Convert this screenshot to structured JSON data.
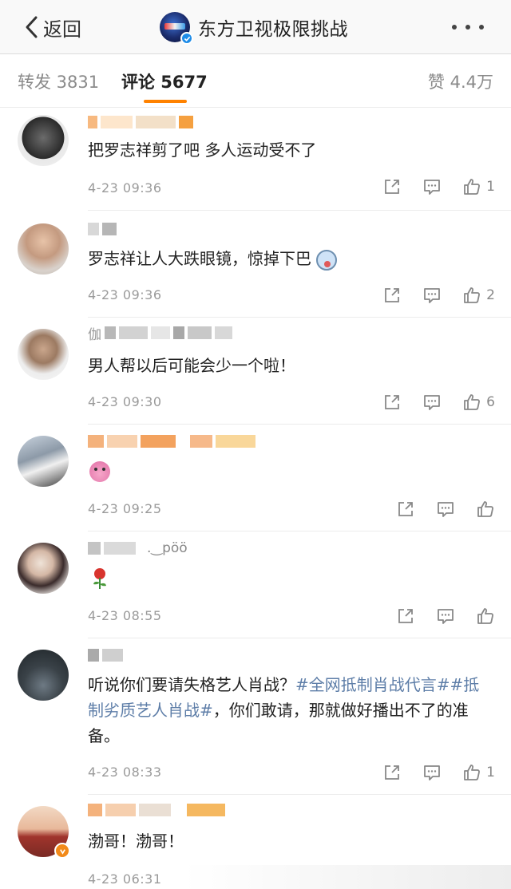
{
  "navbar": {
    "back_label": "返回",
    "title": "东方卫视极限挑战"
  },
  "tabs": {
    "repost": "转发 3831",
    "comment": "评论 5677",
    "like": "赞 4.4万"
  },
  "comments": [
    {
      "text": "把罗志祥剪了吧 多人运动受不了",
      "time": "4-23 09:36",
      "likes": "1"
    },
    {
      "text": "罗志祥让人大跌眼镜，惊掉下巴",
      "time": "4-23 09:36",
      "likes": "2"
    },
    {
      "name_prefix": "伽",
      "text": "男人帮以后可能会少一个啦！",
      "time": "4-23 09:30",
      "likes": "6"
    },
    {
      "text": "",
      "time": "4-23 09:25",
      "likes": ""
    },
    {
      "name_suffix": ".‿pöö",
      "text": "",
      "time": "4-23 08:55",
      "likes": ""
    },
    {
      "text_before": "听说你们要请失格艺人肖战？",
      "tag1": "#全网抵制肖战代言#",
      "tag2": "#抵制劣质艺人肖战#",
      "text_after": "，你们敢请，那就做好播出不了的准备。",
      "time": "4-23 08:33",
      "likes": "1"
    },
    {
      "text": "渤哥！渤哥！",
      "time": "4-23 06:31",
      "likes": ""
    }
  ],
  "colors": {
    "accent": "#ff8200",
    "hashtag": "#5e7ea8",
    "verified": "#1e8ce8"
  }
}
